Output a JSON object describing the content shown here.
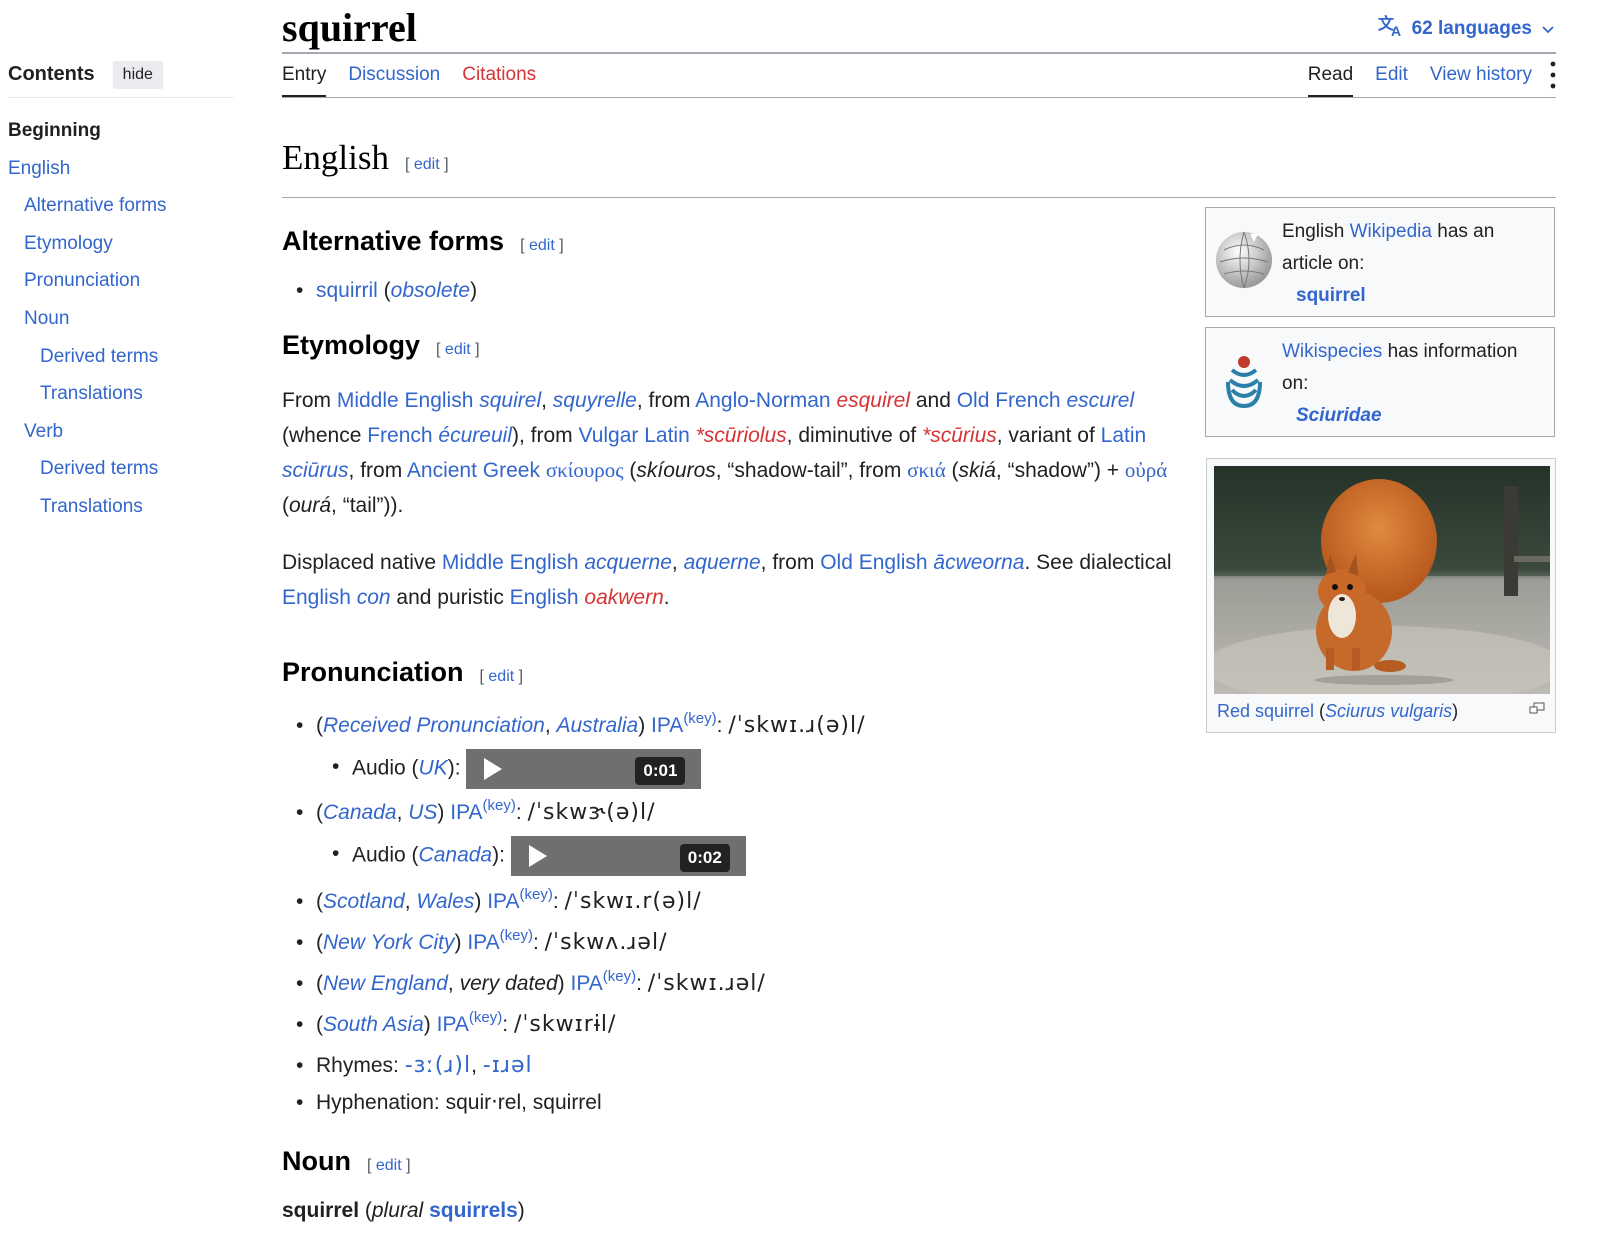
{
  "page_title": "squirrel",
  "languages_label": "62 languages",
  "toc": {
    "title": "Contents",
    "hide_label": "hide",
    "items": [
      {
        "label": "Beginning",
        "level": 0
      },
      {
        "label": "English",
        "level": 0
      },
      {
        "label": "Alternative forms",
        "level": 1
      },
      {
        "label": "Etymology",
        "level": 1
      },
      {
        "label": "Pronunciation",
        "level": 1
      },
      {
        "label": "Noun",
        "level": 1
      },
      {
        "label": "Derived terms",
        "level": 2
      },
      {
        "label": "Translations",
        "level": 2
      },
      {
        "label": "Verb",
        "level": 1
      },
      {
        "label": "Derived terms",
        "level": 2
      },
      {
        "label": "Translations",
        "level": 2
      }
    ]
  },
  "tabs_left": [
    "Entry",
    "Discussion",
    "Citations"
  ],
  "tabs_right": [
    "Read",
    "Edit",
    "View history"
  ],
  "edit_label": "edit",
  "sections": {
    "english": "English",
    "alt_forms": "Alternative forms",
    "etymology": "Etymology",
    "pronunciation": "Pronunciation",
    "noun": "Noun"
  },
  "alt_forms": {
    "word": "squirril",
    "qualifier": "obsolete"
  },
  "etym1": {
    "t1": "From ",
    "l1": "Middle English",
    "t2": " ",
    "w1": "squirel",
    "t3": ", ",
    "w2": "squyrelle",
    "t4": ", from ",
    "l2": "Anglo-Norman",
    "t5": " ",
    "w3": "esquirel",
    "t6": " and ",
    "l3": "Old French",
    "t7": " ",
    "w4": "escurel",
    "t8": " (whence ",
    "l4": "French",
    "t9": " ",
    "w5": "écureuil",
    "t10": "), from ",
    "l5": "Vulgar Latin",
    "t11": " ",
    "w6": "*scūriolus",
    "t12": ", diminutive of ",
    "w7": "*scūrius",
    "t13": ", variant of ",
    "l6": "Latin",
    "t14": " ",
    "w8": "sciūrus",
    "t15": ", from ",
    "l7": "Ancient Greek",
    "t16": " ",
    "w9": "σκίουρος",
    "t17": " (",
    "w9t": "skíouros",
    "t18": ", “shadow-tail”, from ",
    "w10": "σκιά",
    "t19": " (",
    "w10t": "skiá",
    "t20": ", “shadow”) + ",
    "w11": "οὐρά",
    "t21": " (",
    "w11t": "ourá",
    "t22": ", “tail”))."
  },
  "etym2": {
    "t1": "Displaced native ",
    "l1": "Middle English",
    "t2": " ",
    "w1": "acquerne",
    "t3": ", ",
    "w2": "aquerne",
    "t4": ", from ",
    "l2": "Old English",
    "t5": " ",
    "w3": "ācweorna",
    "t6": ". See dialectical ",
    "l3": "English",
    "t7": " ",
    "w4": "con",
    "t8": " and puristic ",
    "l4": "English",
    "t9": " ",
    "w5": "oakwern",
    "t10": "."
  },
  "pron": {
    "ipa_label": "IPA",
    "key_label": "(key)",
    "audio_label": "Audio",
    "rp": {
      "a": "Received Pronunciation",
      "b": "Australia",
      "ipa": "/ˈskwɪ.ɹ(ə)l/"
    },
    "audio_uk": {
      "acc": "UK",
      "time": "0:01"
    },
    "ca": {
      "a": "Canada",
      "b": "US",
      "ipa": "/ˈskwɝ(ə)l/"
    },
    "audio_ca": {
      "acc": "Canada",
      "time": "0:02"
    },
    "sc": {
      "a": "Scotland",
      "b": "Wales",
      "ipa": "/ˈskwɪ.r(ə)l/"
    },
    "ny": {
      "a": "New York City",
      "ipa": "/ˈskwʌ.ɹəl/"
    },
    "ne": {
      "a": "New England",
      "b": "very dated",
      "ipa": "/ˈskwɪ.ɹəl/"
    },
    "sa": {
      "a": "South Asia",
      "ipa": "/ˈskwɪrɨl/"
    },
    "rhymes": {
      "label": "Rhymes: ",
      "r1": "-ɜː(ɹ)l",
      "r2": "-ɪɹəl"
    },
    "hyph": {
      "label": "Hyphenation: ",
      "value": "squir‧rel, squirrel"
    }
  },
  "noun": {
    "headword": "squirrel",
    "plural_label": "plural",
    "plural": "squirrels"
  },
  "wiki_box": {
    "t1": "English ",
    "link": "Wikipedia",
    "t2": " has an article on:",
    "article": "squirrel"
  },
  "species_box": {
    "link": "Wikispecies",
    "t1": " has information on:",
    "article": "Sciuridae"
  },
  "thumb": {
    "caption_link": "Red squirrel",
    "caption_sci": "Sciurus vulgaris"
  },
  "colors": {
    "link": "#3366cc",
    "redlink": "#d73333",
    "text": "#202122"
  }
}
